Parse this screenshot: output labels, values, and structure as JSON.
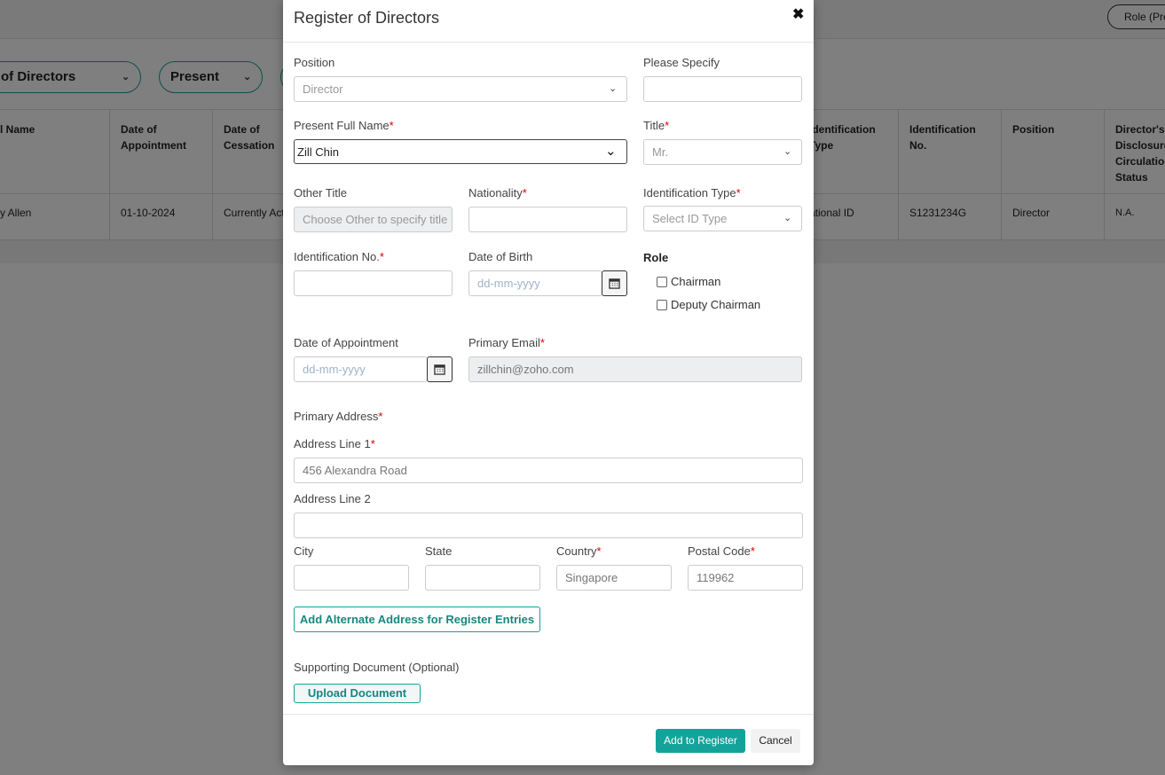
{
  "background": {
    "role_button": "Role (Pre",
    "filters": [
      {
        "label": "of Directors"
      },
      {
        "label": "Present"
      },
      {
        "label": ""
      }
    ],
    "table": {
      "headers": [
        "l Name",
        "Date of Appointment",
        "Date of Cessation",
        "Identification Type",
        "Identification No.",
        "Position",
        "Director's Disclosure Circulation Status"
      ],
      "row": [
        "y Allen",
        "01-10-2024",
        "Currently Act",
        "ational ID",
        "S1231234G",
        "Director",
        "N.A."
      ]
    }
  },
  "modal": {
    "title": "Register of Directors",
    "fields": {
      "position": {
        "label": "Position",
        "value": "Director"
      },
      "please_specify": {
        "label": "Please Specify",
        "value": ""
      },
      "full_name": {
        "label": "Present Full Name",
        "required": "*",
        "value": "Zill Chin"
      },
      "title": {
        "label": "Title",
        "required": "*",
        "value": "Mr."
      },
      "other_title": {
        "label": "Other Title",
        "placeholder": "Choose Other to specify title"
      },
      "nationality": {
        "label": "Nationality",
        "required": "*",
        "value": ""
      },
      "id_type": {
        "label": "Identification Type",
        "required": "*",
        "placeholder": "Select ID Type"
      },
      "id_no": {
        "label": "Identification No.",
        "required": "*",
        "value": ""
      },
      "dob": {
        "label": "Date of Birth",
        "placeholder": "dd-mm-yyyy"
      },
      "role": {
        "label": "Role",
        "options": [
          "Chairman",
          "Deputy Chairman"
        ]
      },
      "doa": {
        "label": "Date of Appointment",
        "placeholder": "dd-mm-yyyy"
      },
      "email": {
        "label": "Primary Email",
        "required": "*",
        "value": "zillchin@zoho.com"
      },
      "primary_address": {
        "label": "Primary Address",
        "required": "*"
      },
      "address1": {
        "label": "Address Line 1",
        "required": "*",
        "value": "456 Alexandra Road"
      },
      "address2": {
        "label": "Address Line 2",
        "value": ""
      },
      "city": {
        "label": "City",
        "value": ""
      },
      "state": {
        "label": "State",
        "value": ""
      },
      "country": {
        "label": "Country",
        "required": "*",
        "value": "Singapore"
      },
      "postal": {
        "label": "Postal Code",
        "required": "*",
        "value": "119962"
      }
    },
    "alt_address_button": "Add Alternate Address for Register Entries",
    "supporting_doc_label": "Supporting Document (Optional)",
    "upload_button": "Upload Document",
    "footer": {
      "add_button": "Add to Register",
      "cancel_button": "Cancel"
    }
  },
  "colors": {
    "accent": "#14a39a",
    "required": "#dd0000",
    "overlay": "rgba(0,0,0,0.5)"
  },
  "icons": {
    "close": "close-icon",
    "select": "chevron-down-icon",
    "date": "calendar-icon"
  }
}
